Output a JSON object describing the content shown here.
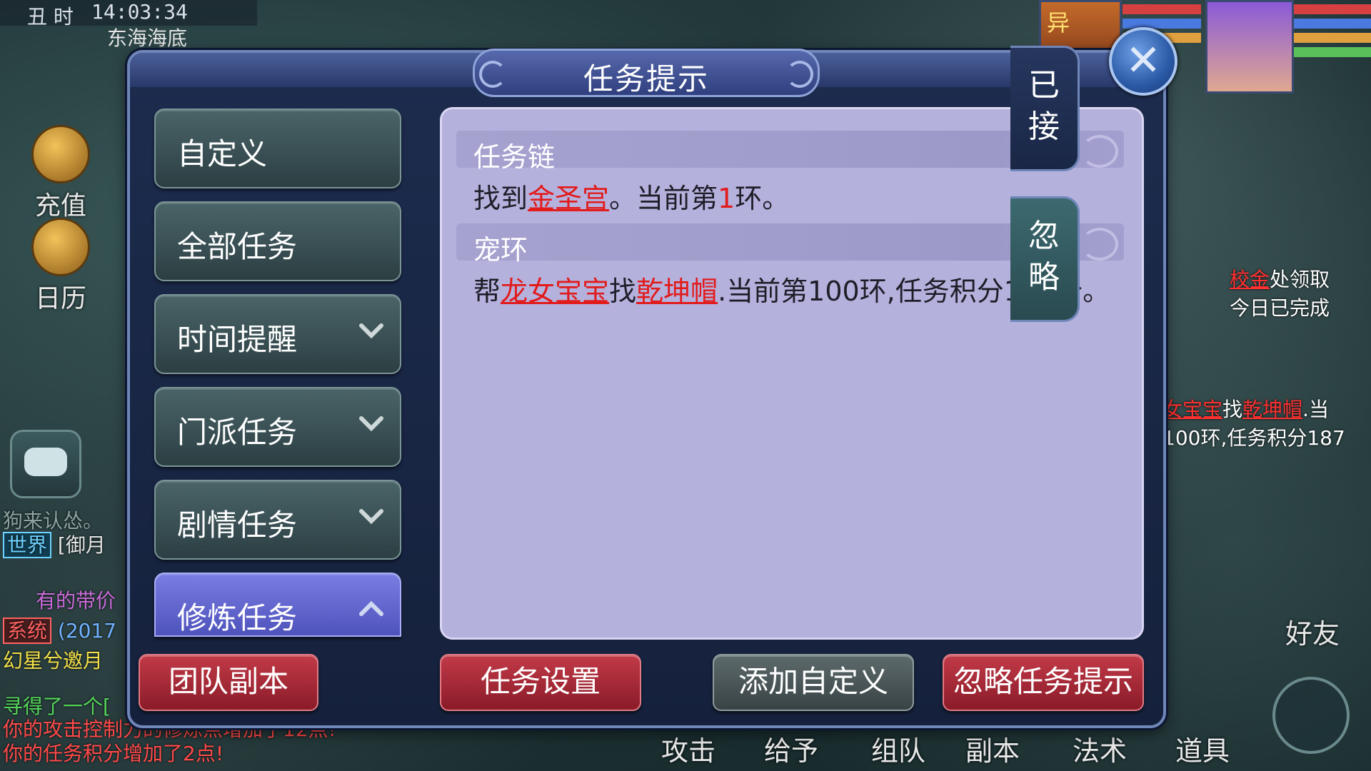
{
  "hud": {
    "time_zone": "丑 时",
    "clock": "14:03:34",
    "location": "东海海底",
    "left_icons": [
      "充值",
      "日历"
    ],
    "right_bg_text": {
      "line1_hl": "校金",
      "line1_rest": "处领取",
      "line2": "今日已完成",
      "line3_hl1": "女宝宝",
      "line3_mid": "找",
      "line3_hl2": "乾坤帽",
      "line3_rest": ".当",
      "line4": "100环,任务积分187"
    },
    "chat": {
      "channel": "世界",
      "channel_rest": "[御月",
      "faint": "狗来认怂。",
      "line_purple": "有的带价",
      "sys_tag": "系统",
      "sys_rest": "(2017",
      "line_yellow": "幻星兮邀月",
      "line_green": "寻得了一个[",
      "line_red1": "你的攻击控制力的修炼点增加了12点!",
      "line_red2": "你的任务积分增加了2点!"
    },
    "bottom_bar": [
      "攻击",
      "给予",
      "组队",
      "副本",
      "法术",
      "道具"
    ],
    "friend": "好友",
    "portrait_tag": "异"
  },
  "dialog": {
    "title": "任务提示",
    "close_icon": "close-icon",
    "categories": [
      {
        "label": "自定义",
        "expandable": false
      },
      {
        "label": "全部任务",
        "expandable": false
      },
      {
        "label": "时间提醒",
        "expandable": true
      },
      {
        "label": "门派任务",
        "expandable": true
      },
      {
        "label": "剧情任务",
        "expandable": true
      },
      {
        "label": "修炼任务",
        "expandable": true,
        "active": true
      }
    ],
    "sections": [
      {
        "title": "任务链",
        "t1": "找到",
        "t2": "金圣宫",
        "t3": "。当前第",
        "t4": "1",
        "t5": "环。"
      },
      {
        "title": "宠环",
        "t1": "帮",
        "t2": "龙女宝宝",
        "t3": "找",
        "t4": "乾坤帽",
        "t5": ".当前第100环,任务积分187分。"
      }
    ],
    "side_tabs": {
      "accepted": "已接",
      "ignore": "忽略"
    },
    "buttons": {
      "team_dungeon": "团队副本",
      "task_settings": "任务设置",
      "add_custom": "添加自定义",
      "ignore_hint": "忽略任务提示"
    }
  },
  "colors": {
    "highlight": "#e21b1b",
    "panel_bg": "#b5b1dd",
    "active_category": "#6a6ed6",
    "red_button": "#a82a38"
  }
}
